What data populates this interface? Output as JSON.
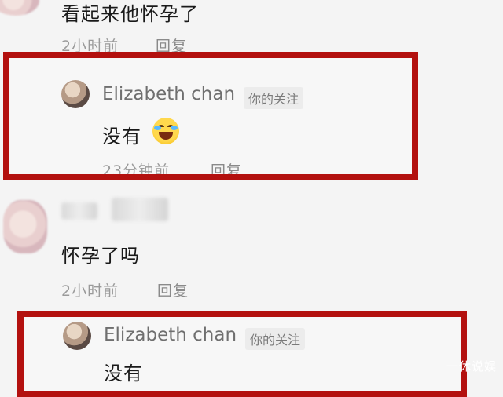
{
  "comments": [
    {
      "text": "看起来他怀孕了",
      "time": "2小时前",
      "reply_label": "回复"
    },
    {
      "username": "Elizabeth chan",
      "follow_tag": "你的关注",
      "text": "没有",
      "emoji": "face-with-tears-of-joy",
      "time": "23分钟前",
      "reply_label": "回复",
      "highlighted": true
    },
    {
      "text": "怀孕了吗",
      "time": "2小时前",
      "reply_label": "回复"
    },
    {
      "username": "Elizabeth chan",
      "follow_tag": "你的关注",
      "text": "没有",
      "highlighted": true
    }
  ],
  "watermark": "一休说娱",
  "colors": {
    "highlight_border": "#b3110f",
    "background": "#f4f4f4"
  }
}
